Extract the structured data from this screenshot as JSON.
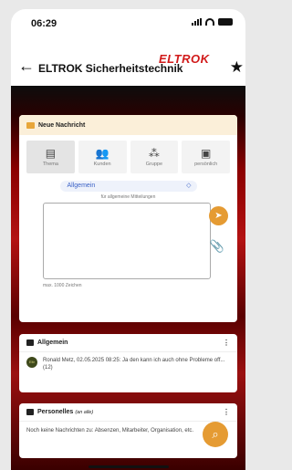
{
  "status": {
    "time": "06:29"
  },
  "header": {
    "title": "ELTROK Sicherheitstechnik",
    "logo": "ELTROK",
    "back_icon": "arrow-left-icon",
    "star_icon": "star-icon"
  },
  "new_message": {
    "title": "Neue Nachricht",
    "tabs": [
      {
        "label": "Thema",
        "icon": "clipboard-icon"
      },
      {
        "label": "Kunden",
        "icon": "users-icon"
      },
      {
        "label": "Gruppe",
        "icon": "group-icon"
      },
      {
        "label": "persönlich",
        "icon": "person-card-icon"
      }
    ],
    "topic": "Allgemein",
    "topic_hint": "für allgemeine Mitteilungen",
    "text_value": "",
    "max_chars": "max. 1000 Zeichen"
  },
  "sections": {
    "allgemein": {
      "title": "Allgemein",
      "avatar_text": "Eltr",
      "message": "Ronald Metz, 02.05.2025 08:25: Ja den kann ich auch ohne Probleme off... (12)"
    },
    "personelles": {
      "title": "Personelles",
      "subtitle": "(an alle)",
      "message": "Noch keine Nachrichten zu: Absenzen, Mitarbeiter, Organisation, etc."
    }
  },
  "colors": {
    "accent": "#e59b33",
    "brand": "#d11a1a",
    "link": "#3b62c6"
  }
}
